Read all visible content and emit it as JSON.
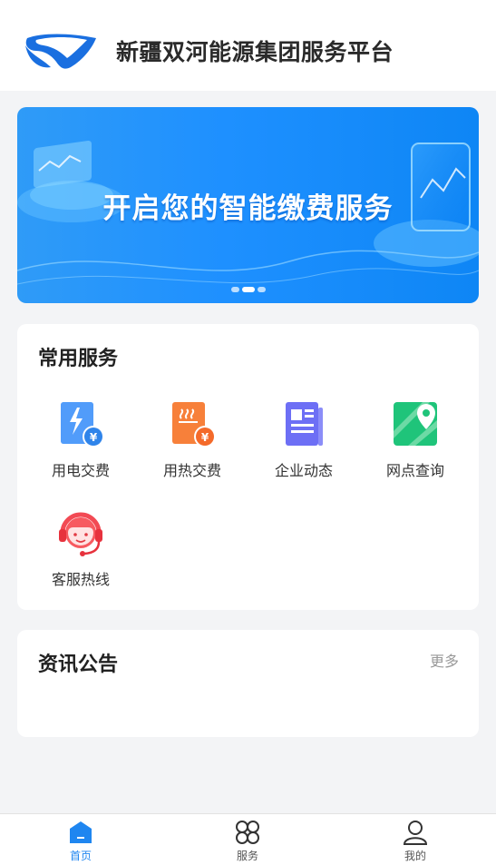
{
  "header": {
    "title": "新疆双河能源集团服务平台"
  },
  "banner": {
    "text": "开启您的智能缴费服务",
    "slide_count": 3,
    "active_index": 1
  },
  "services": {
    "title": "常用服务",
    "items": [
      {
        "label": "用电交费",
        "icon": "electricity-pay-icon"
      },
      {
        "label": "用热交费",
        "icon": "heating-pay-icon"
      },
      {
        "label": "企业动态",
        "icon": "news-icon"
      },
      {
        "label": "网点查询",
        "icon": "map-pin-icon"
      },
      {
        "label": "客服热线",
        "icon": "customer-service-icon"
      }
    ]
  },
  "news": {
    "title": "资讯公告",
    "more": "更多"
  },
  "tabbar": {
    "items": [
      {
        "label": "首页",
        "icon": "home-icon",
        "active": true
      },
      {
        "label": "服务",
        "icon": "grid-icon",
        "active": false
      },
      {
        "label": "我的",
        "icon": "user-icon",
        "active": false
      }
    ]
  },
  "colors": {
    "accent": "#1f86f0",
    "background": "#f3f4f6"
  }
}
